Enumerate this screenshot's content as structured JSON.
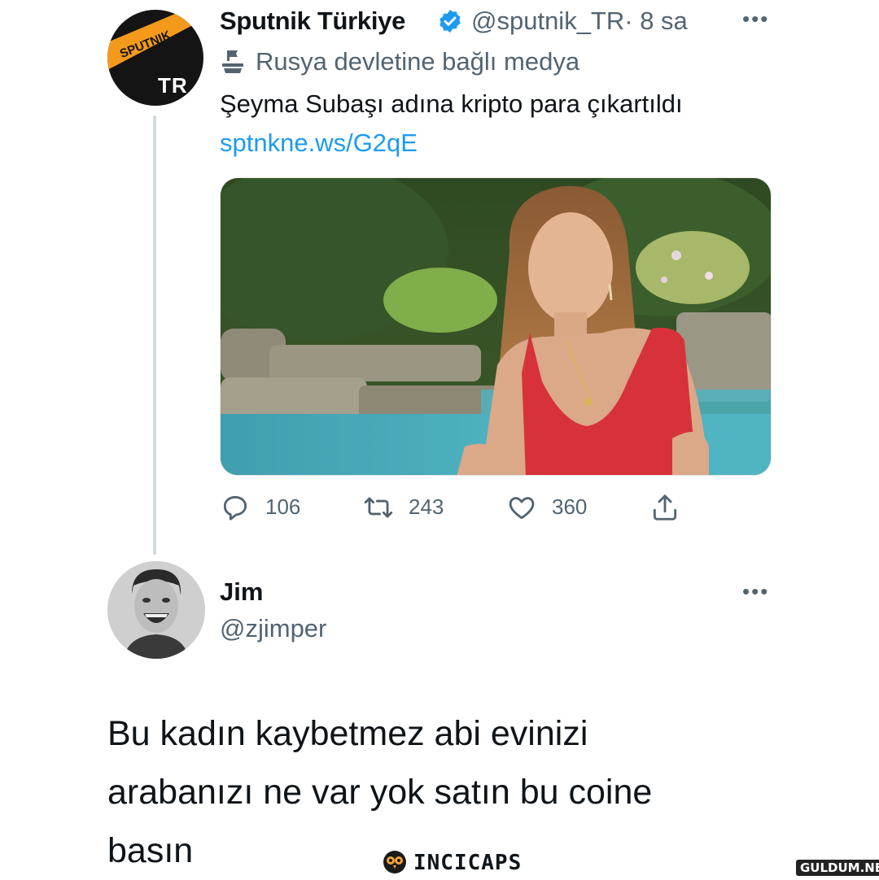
{
  "tweet": {
    "author_name": "Sputnik Türkiye",
    "handle": "@sputnik_TR",
    "time": "· 8 sa",
    "more_icon": "more-dots",
    "state_label": "Rusya devletine bağlı medya",
    "text": "Şeyma Subaşı adına kripto para çıkartıldı",
    "link": "sptnkne.ws/G2qE",
    "avatar_logo_text": "SPUTNIK",
    "avatar_sub": "TR",
    "brand_color": "#f39a1d",
    "counts": {
      "replies": "106",
      "retweets": "243",
      "likes": "360"
    }
  },
  "reply": {
    "author_name": "Jim",
    "handle": "@zjimper",
    "text": "Bu kadın kaybetmez abi evinizi\narabanızı ne var yok satın bu coine\nbasın"
  },
  "watermarks": {
    "incicaps": "INCICAPS",
    "guldum": "GULDUM.NET"
  },
  "colors": {
    "secondary_text": "#536471",
    "link": "#1d9bf0",
    "verified": "#1d9bf0"
  }
}
